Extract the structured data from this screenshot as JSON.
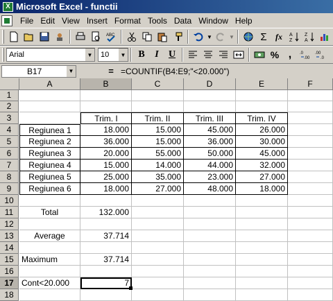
{
  "window": {
    "title": "Microsoft Excel - functii",
    "app_icon": "excel-icon"
  },
  "menu": [
    "File",
    "Edit",
    "View",
    "Insert",
    "Format",
    "Tools",
    "Data",
    "Window",
    "Help"
  ],
  "toolbar": {
    "font": "Arial",
    "size": "10",
    "bold": "B",
    "italic": "I",
    "underline": "U",
    "percent": "%",
    "comma": ",",
    "sigma": "Σ",
    "fx": "fx"
  },
  "formula_bar": {
    "name_box": "B17",
    "equals": "=",
    "formula": "=COUNTIF(B4:E9;\"<20.000\")"
  },
  "columns": [
    "A",
    "B",
    "C",
    "D",
    "E",
    "F"
  ],
  "rows": [
    "1",
    "2",
    "3",
    "4",
    "5",
    "6",
    "7",
    "8",
    "9",
    "10",
    "11",
    "12",
    "13",
    "14",
    "15",
    "16",
    "17",
    "18"
  ],
  "headers": [
    "Trim. I",
    "Trim. II",
    "Trim. III",
    "Trim. IV"
  ],
  "data": [
    {
      "label": "Regiunea 1",
      "values": [
        "18.000",
        "15.000",
        "45.000",
        "26.000"
      ]
    },
    {
      "label": "Regiunea 2",
      "values": [
        "36.000",
        "15.000",
        "36.000",
        "30.000"
      ]
    },
    {
      "label": "Regiunea 3",
      "values": [
        "20.000",
        "55.000",
        "50.000",
        "45.000"
      ]
    },
    {
      "label": "Regiunea 4",
      "values": [
        "15.000",
        "14.000",
        "44.000",
        "32.000"
      ]
    },
    {
      "label": "Regiunea 5",
      "values": [
        "25.000",
        "35.000",
        "23.000",
        "27.000"
      ]
    },
    {
      "label": "Regiunea 6",
      "values": [
        "18.000",
        "27.000",
        "48.000",
        "18.000"
      ]
    }
  ],
  "summary": {
    "total_label": "Total",
    "total_value": "132.000",
    "average_label": "Average",
    "average_value": "37.714",
    "maximum_label": "Maximum",
    "maximum_value": "37.714",
    "count_label": "Cont<20.000",
    "count_value": "7"
  }
}
